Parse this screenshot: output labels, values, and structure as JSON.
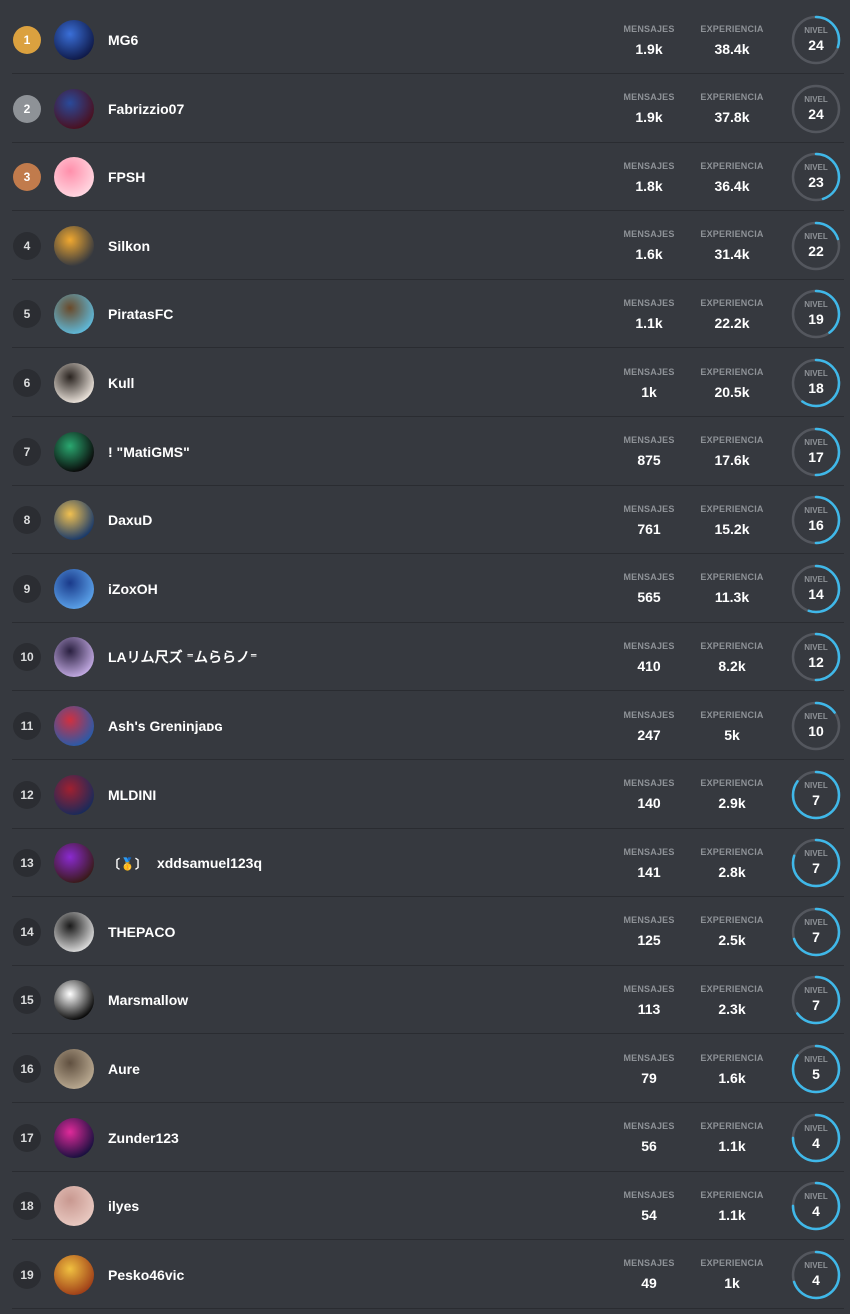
{
  "labels": {
    "messages": "MENSAJES",
    "experience": "EXPERIENCIA",
    "level": "NIVEL"
  },
  "colors": {
    "ring": "#3fb8e9",
    "ring_track": "#54575e",
    "gold": "#dba13f",
    "silver": "#8e9297",
    "bronze": "#c17b4c"
  },
  "players": [
    {
      "rank": "1",
      "name": "MG6",
      "messages": "1.9k",
      "experience": "38.4k",
      "level": "24",
      "progress": 0.3,
      "avatar": [
        "#0f1a4a",
        "#3a6fd8"
      ]
    },
    {
      "rank": "2",
      "name": "Fabrizzio07",
      "messages": "1.9k",
      "experience": "37.8k",
      "level": "24",
      "progress": 0.0,
      "avatar": [
        "#4a1020",
        "#2a4a9a"
      ]
    },
    {
      "rank": "3",
      "name": "FPSH",
      "messages": "1.8k",
      "experience": "36.4k",
      "level": "23",
      "progress": 0.45,
      "avatar": [
        "#ffd6e0",
        "#ff8fab"
      ]
    },
    {
      "rank": "4",
      "name": "Silkon",
      "messages": "1.6k",
      "experience": "31.4k",
      "level": "22",
      "progress": 0.2,
      "avatar": [
        "#36393f",
        "#f0a830"
      ]
    },
    {
      "rank": "5",
      "name": "PiratasFC",
      "messages": "1.1k",
      "experience": "22.2k",
      "level": "19",
      "progress": 0.4,
      "avatar": [
        "#5fb8d8",
        "#6a4a2a"
      ]
    },
    {
      "rank": "6",
      "name": "Kull",
      "messages": "1k",
      "experience": "20.5k",
      "level": "18",
      "progress": 0.6,
      "avatar": [
        "#e8e0d8",
        "#2a2420"
      ]
    },
    {
      "rank": "7",
      "name": "! \"MatiGMS\"",
      "messages": "875",
      "experience": "17.6k",
      "level": "17",
      "progress": 0.5,
      "avatar": [
        "#0a0a0a",
        "#2aa870"
      ]
    },
    {
      "rank": "8",
      "name": "DaxuD",
      "messages": "761",
      "experience": "15.2k",
      "level": "16",
      "progress": 0.5,
      "avatar": [
        "#1a3a6a",
        "#f0c050"
      ]
    },
    {
      "rank": "9",
      "name": "iZoxOH",
      "messages": "565",
      "experience": "11.3k",
      "level": "14",
      "progress": 0.55,
      "avatar": [
        "#5aa0e8",
        "#1a3a8a"
      ]
    },
    {
      "rank": "10",
      "name": "LAリム尺ズ ⁼ムららノ⁼",
      "messages": "410",
      "experience": "8.2k",
      "level": "12",
      "progress": 0.5,
      "avatar": [
        "#c0a8e0",
        "#2a2040"
      ]
    },
    {
      "rank": "11",
      "name": "Ash's Greninjaᴅɢ",
      "messages": "247",
      "experience": "5k",
      "level": "10",
      "progress": 0.15,
      "avatar": [
        "#2a5aa8",
        "#d03040"
      ]
    },
    {
      "rank": "12",
      "name": "MLDINI",
      "messages": "140",
      "experience": "2.9k",
      "level": "7",
      "progress": 0.85,
      "avatar": [
        "#1a2a5a",
        "#a02030"
      ]
    },
    {
      "rank": "13",
      "name": "xddsamuel123q",
      "badge": "〔🥇〕",
      "messages": "141",
      "experience": "2.8k",
      "level": "7",
      "progress": 0.8,
      "avatar": [
        "#3a1a1a",
        "#8a2ad0"
      ]
    },
    {
      "rank": "14",
      "name": "THEPACO",
      "messages": "125",
      "experience": "2.5k",
      "level": "7",
      "progress": 0.7,
      "avatar": [
        "#d8d8d8",
        "#1a1a1a"
      ]
    },
    {
      "rank": "15",
      "name": "Marsmallow",
      "messages": "113",
      "experience": "2.3k",
      "level": "7",
      "progress": 0.65,
      "avatar": [
        "#0a0a0a",
        "#ffffff"
      ]
    },
    {
      "rank": "16",
      "name": "Aure",
      "messages": "79",
      "experience": "1.6k",
      "level": "5",
      "progress": 0.85,
      "avatar": [
        "#b8a890",
        "#605040"
      ]
    },
    {
      "rank": "17",
      "name": "Zunder123",
      "messages": "56",
      "experience": "1.1k",
      "level": "4",
      "progress": 0.75,
      "avatar": [
        "#1a1040",
        "#e02a9a"
      ]
    },
    {
      "rank": "18",
      "name": "ilyes",
      "messages": "54",
      "experience": "1.1k",
      "level": "4",
      "progress": 0.75,
      "avatar": [
        "#e8c8c0",
        "#c89890"
      ]
    },
    {
      "rank": "19",
      "name": "Pesko46vic",
      "messages": "49",
      "experience": "1k",
      "level": "4",
      "progress": 0.7,
      "avatar": [
        "#a04018",
        "#f0c040"
      ]
    }
  ]
}
